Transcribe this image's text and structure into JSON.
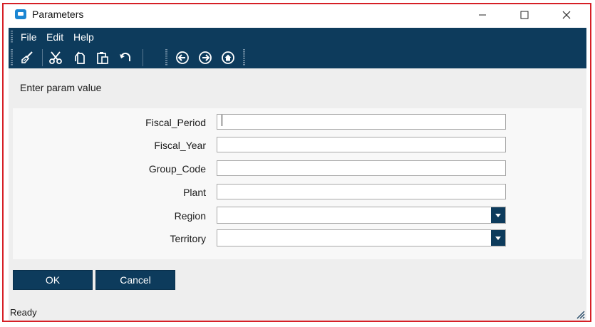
{
  "window": {
    "title": "Parameters",
    "minimize_icon": "minimize-icon",
    "maximize_icon": "maximize-icon",
    "close_icon": "close-icon"
  },
  "menu": {
    "items": [
      "File",
      "Edit",
      "Help"
    ]
  },
  "toolbar": {
    "icons": [
      "broom-icon",
      "cut-icon",
      "copy-icon",
      "paste-icon",
      "undo-icon",
      "back-icon",
      "forward-icon",
      "home-icon"
    ]
  },
  "prompt": {
    "text": "Enter param value"
  },
  "fields": [
    {
      "label": "Fiscal_Period",
      "type": "text",
      "value": ""
    },
    {
      "label": "Fiscal_Year",
      "type": "text",
      "value": ""
    },
    {
      "label": "Group_Code",
      "type": "text",
      "value": ""
    },
    {
      "label": "Plant",
      "type": "text",
      "value": ""
    },
    {
      "label": "Region",
      "type": "select",
      "value": ""
    },
    {
      "label": "Territory",
      "type": "select",
      "value": ""
    }
  ],
  "buttons": {
    "ok": "OK",
    "cancel": "Cancel"
  },
  "status": {
    "text": "Ready"
  },
  "colors": {
    "accent": "#0d3b5c",
    "frame_border": "#d61f26",
    "panel_bg": "#eeeeee"
  }
}
